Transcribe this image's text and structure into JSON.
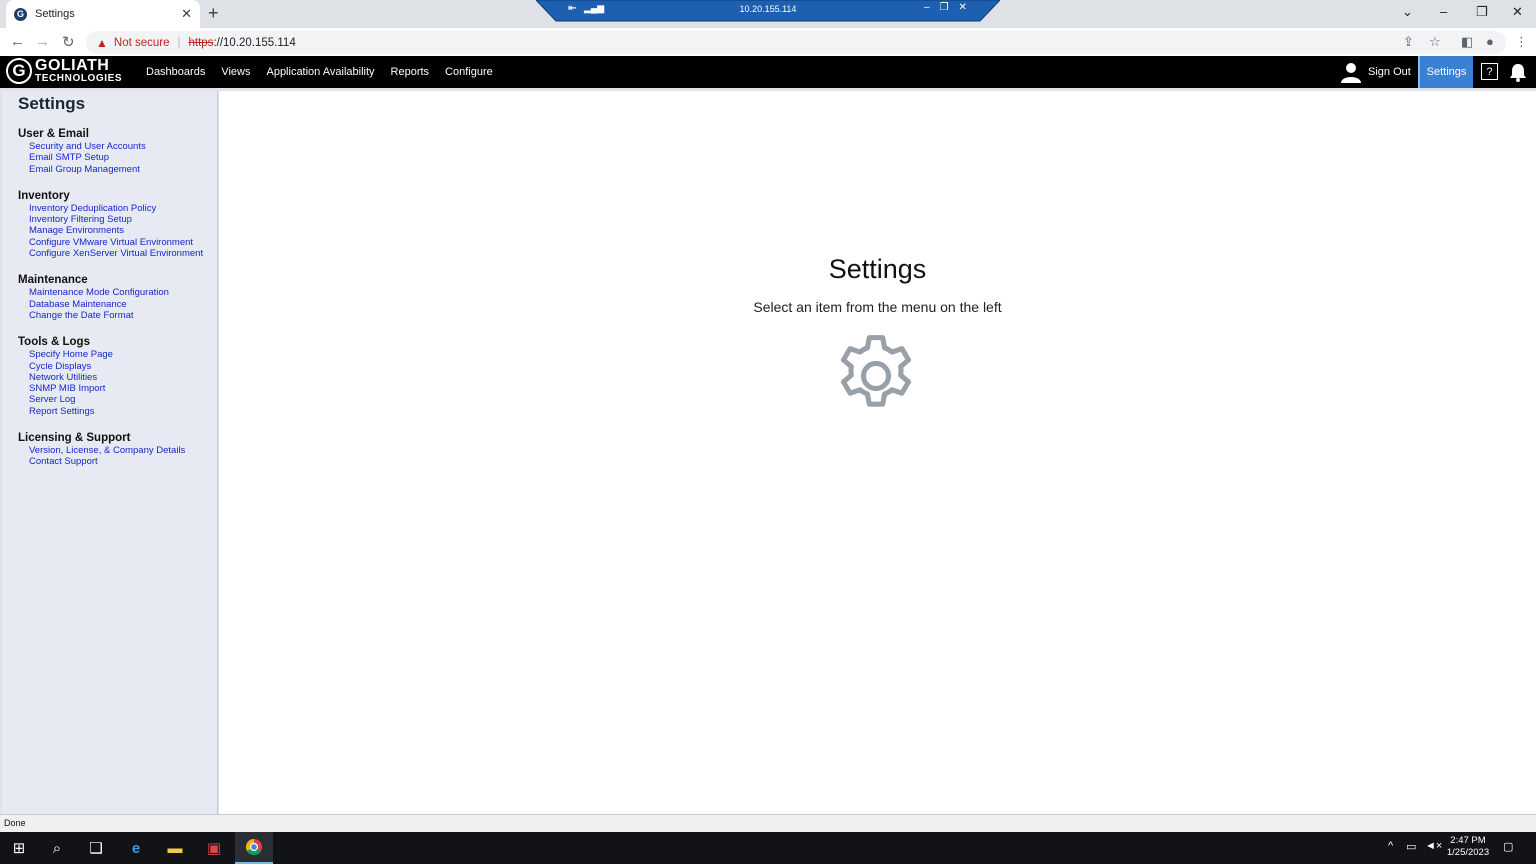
{
  "browser": {
    "tab_title": "Settings",
    "tab_close": "✕",
    "new_tab": "+",
    "url_warning": "Not secure",
    "url_scheme": "https",
    "url_rest": "://10.20.155.114",
    "rdp_ip": "10.20.155.114"
  },
  "nav": {
    "logo_line1": "GOLIATH",
    "logo_line2": "TECHNOLOGIES",
    "menu": [
      "Dashboards",
      "Views",
      "Application Availability",
      "Reports",
      "Configure"
    ],
    "sign_out": "Sign Out",
    "settings": "Settings",
    "help": "?"
  },
  "sidebar": {
    "title": "Settings",
    "sections": [
      {
        "title": "User & Email",
        "items": [
          "Security and User Accounts",
          "Email SMTP Setup",
          "Email Group Management"
        ]
      },
      {
        "title": "Inventory",
        "items": [
          "Inventory Deduplication Policy",
          "Inventory Filtering Setup",
          "Manage Environments",
          "Configure VMware Virtual Environment",
          "Configure XenServer Virtual Environment"
        ]
      },
      {
        "title": "Maintenance",
        "items": [
          "Maintenance Mode Configuration",
          "Database Maintenance",
          "Change the Date Format"
        ]
      },
      {
        "title": "Tools & Logs",
        "items": [
          "Specify Home Page",
          "Cycle Displays",
          "Network Utilities",
          "SNMP MIB Import",
          "Server Log",
          "Report Settings"
        ]
      },
      {
        "title": "Licensing & Support",
        "items": [
          "Version, License, & Company Details",
          "Contact Support"
        ]
      }
    ]
  },
  "main": {
    "title": "Settings",
    "subtitle": "Select an item from the menu on the left",
    "icon": "gear-icon"
  },
  "status": {
    "text": "Done"
  },
  "taskbar": {
    "time": "2:47 PM",
    "date": "1/25/2023"
  },
  "colors": {
    "nav_bg": "#000000",
    "settings_active": "#3a80d4",
    "link": "#1428c8",
    "sidebar_bg": "#e7eaf3"
  }
}
